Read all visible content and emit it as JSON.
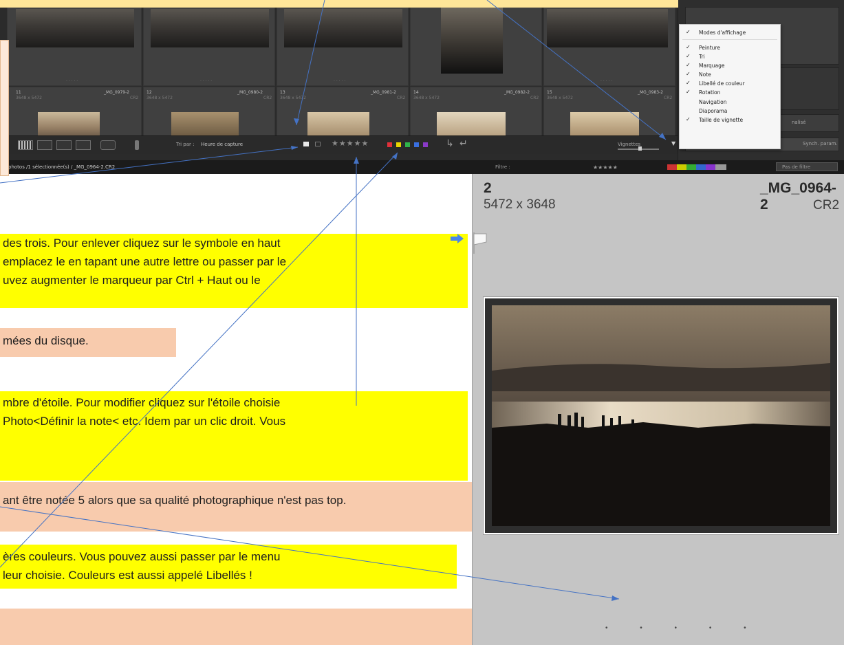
{
  "grid": {
    "cells": [
      {
        "num": "11",
        "file": "_MG_0979-2",
        "dims": "3648 x 5472",
        "ext": "CR2"
      },
      {
        "num": "12",
        "file": "_MG_0980-2",
        "dims": "3648 x 5472",
        "ext": "CR2"
      },
      {
        "num": "13",
        "file": "_MG_0981-2",
        "dims": "3648 x 5472",
        "ext": "CR2"
      },
      {
        "num": "14",
        "file": "_MG_0982-2",
        "dims": "3648 x 5472",
        "ext": "CR2"
      },
      {
        "num": "15",
        "file": "_MG_0983-2",
        "dims": "3648 x 5472",
        "ext": "CR2"
      }
    ],
    "row_dots": ". . . . ."
  },
  "toolbar": {
    "sort_label": "Tri par :",
    "sort_value": "Heure de capture",
    "stars": "★★★★★",
    "thumb_label": "Vignettes",
    "right_label": "nalisé",
    "right_button": "Synch. param."
  },
  "statusbar": {
    "path": "photos /1 sélectionnée(s) / _MG_0964-2.CR2",
    "filter_label": "Filtre :",
    "filter_stars": "★★★★★",
    "filter_value": "Pas de filtre"
  },
  "context_menu": {
    "items": [
      {
        "label": "Modes d'affichage",
        "checked": "✓"
      },
      {
        "label": "Peinture",
        "checked": "✓"
      },
      {
        "label": "Tri",
        "checked": "✓"
      },
      {
        "label": "Marquage",
        "checked": "✓"
      },
      {
        "label": "Note",
        "checked": "✓"
      },
      {
        "label": "Libellé de couleur",
        "checked": "✓"
      },
      {
        "label": "Rotation",
        "checked": "✓"
      },
      {
        "label": "Navigation",
        "checked": ""
      },
      {
        "label": "Diaporama",
        "checked": ""
      },
      {
        "label": "Taille de vignette",
        "checked": "✓"
      }
    ]
  },
  "notes": {
    "flag": [
      " des trois. Pour enlever cliquez sur le symbole en haut",
      "emplacez le en tapant une autre lettre ou passer par le",
      "uvez augmenter le marqueur par Ctrl + Haut ou le"
    ],
    "disk": "mées du disque.",
    "stars": [
      "mbre d'étoile. Pour modifier cliquez sur l'étoile choisie",
      "Photo<Définir la note< etc. Idem par un clic droit. Vous"
    ],
    "quality": "ant être notée 5 alors que sa qualité photographique n'est pas top.",
    "colors": [
      "ères couleurs. Vous pouvez aussi passer par le menu",
      "leur choisie. Couleurs est aussi appelé Libellés !"
    ]
  },
  "detail": {
    "index": "2",
    "dims": "5472 x 3648",
    "file": "_MG_0964-2",
    "ext": "CR2",
    "rating_dots": "• • • • •"
  },
  "colors": {
    "yellow": "#ffff00",
    "peach": "#f8cbad",
    "arrow_line": "#4472c4",
    "label_red": "#e0303a",
    "label_yellow": "#e8d400",
    "label_green": "#2fb34a",
    "label_blue": "#3a6fe0",
    "label_purple": "#8a3ac8"
  }
}
